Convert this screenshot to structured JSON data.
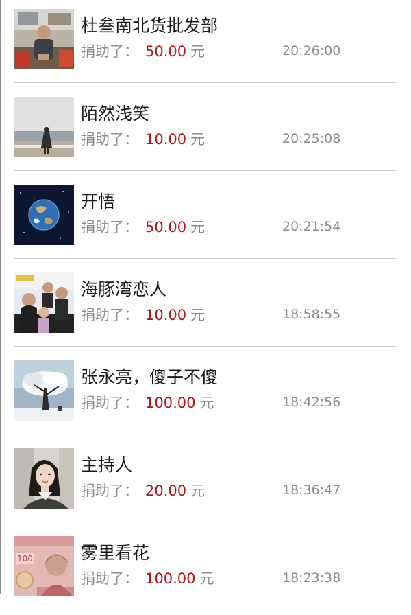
{
  "donations": [
    {
      "name": "杜叁南北货批发部",
      "prefix": "捐助了：",
      "amount": "50.00",
      "unit": "元",
      "time": "20:26:00",
      "avatar": "portrait-man-in-shop"
    },
    {
      "name": "陌然浅笑",
      "prefix": "捐助了：",
      "amount": "10.00",
      "unit": "元",
      "time": "20:25:08",
      "avatar": "figure-on-beach"
    },
    {
      "name": "开悟",
      "prefix": "捐助了：",
      "amount": "50.00",
      "unit": "元",
      "time": "20:21:54",
      "avatar": "earth-in-space"
    },
    {
      "name": "海豚湾恋人",
      "prefix": "捐助了：",
      "amount": "10.00",
      "unit": "元",
      "time": "18:58:55",
      "avatar": "family-photo"
    },
    {
      "name": "张永亮，傻子不傻",
      "prefix": "捐助了：",
      "amount": "100.00",
      "unit": "元",
      "time": "18:42:56",
      "avatar": "snowy-tree"
    },
    {
      "name": "主持人",
      "prefix": "捐助了：",
      "amount": "20.00",
      "unit": "元",
      "time": "18:36:47",
      "avatar": "woman-portrait"
    },
    {
      "name": "雾里看花",
      "prefix": "捐助了：",
      "amount": "100.00",
      "unit": "元",
      "time": "18:23:38",
      "avatar": "banknote-100-yuan"
    }
  ],
  "colors": {
    "amount": "#b01818",
    "secondary_text": "#8c8c8c",
    "primary_text": "#1a1a1a",
    "divider": "#cfcfcf"
  }
}
